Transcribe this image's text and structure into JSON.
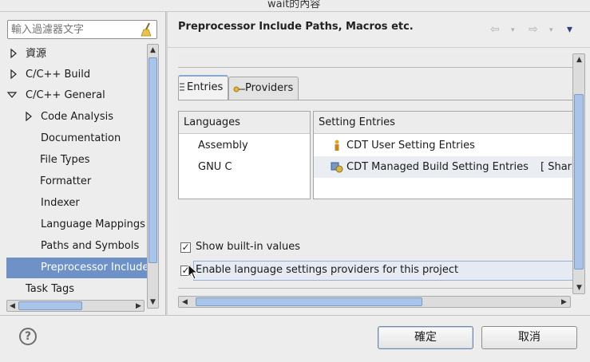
{
  "window": {
    "title": "wait的內容"
  },
  "filter": {
    "placeholder": "輸入過濾器文字"
  },
  "tree": {
    "items": [
      {
        "label": "資源",
        "expand": "collapsed"
      },
      {
        "label": "C/C++ Build",
        "expand": "collapsed"
      },
      {
        "label": "C/C++ General",
        "expand": "expanded"
      },
      {
        "label": "Code Analysis",
        "expand": "collapsed"
      },
      {
        "label": "Documentation",
        "expand": "none"
      },
      {
        "label": "File Types",
        "expand": "none"
      },
      {
        "label": "Formatter",
        "expand": "none"
      },
      {
        "label": "Indexer",
        "expand": "none"
      },
      {
        "label": "Language Mappings",
        "expand": "none"
      },
      {
        "label": "Paths and Symbols",
        "expand": "none"
      },
      {
        "label": "Preprocessor Include Paths, Macros etc.",
        "expand": "none",
        "selected": true
      },
      {
        "label": "Task Tags",
        "expand": "none"
      }
    ]
  },
  "page": {
    "title": "Preprocessor Include Paths, Macros etc.",
    "nav": {
      "back": "⇦",
      "forward": "⇨",
      "menu": "▾"
    }
  },
  "tabs": [
    {
      "label": "Entries",
      "active": true
    },
    {
      "label": "Providers",
      "active": false
    }
  ],
  "languages": {
    "header": "Languages",
    "items": [
      "Assembly",
      "GNU C"
    ]
  },
  "setting_entries": {
    "header": "Setting Entries",
    "items": [
      {
        "label": "CDT User Setting Entries",
        "icon": "user-settings-icon"
      },
      {
        "label": "CDT Managed Build Setting Entries",
        "suffix": "[ Shar",
        "icon": "managed-build-icon"
      }
    ]
  },
  "options": {
    "show_builtin": {
      "label": "Show built-in values",
      "checked": true
    },
    "enable_providers": {
      "label": "Enable language settings providers for this project",
      "checked": true
    }
  },
  "buttons": {
    "ok": "確定",
    "cancel": "取消",
    "help": "?"
  },
  "colors": {
    "selection": "#6e92c8",
    "scroll_thumb": "#a9c3e9",
    "focus": "#9ab1d6"
  }
}
